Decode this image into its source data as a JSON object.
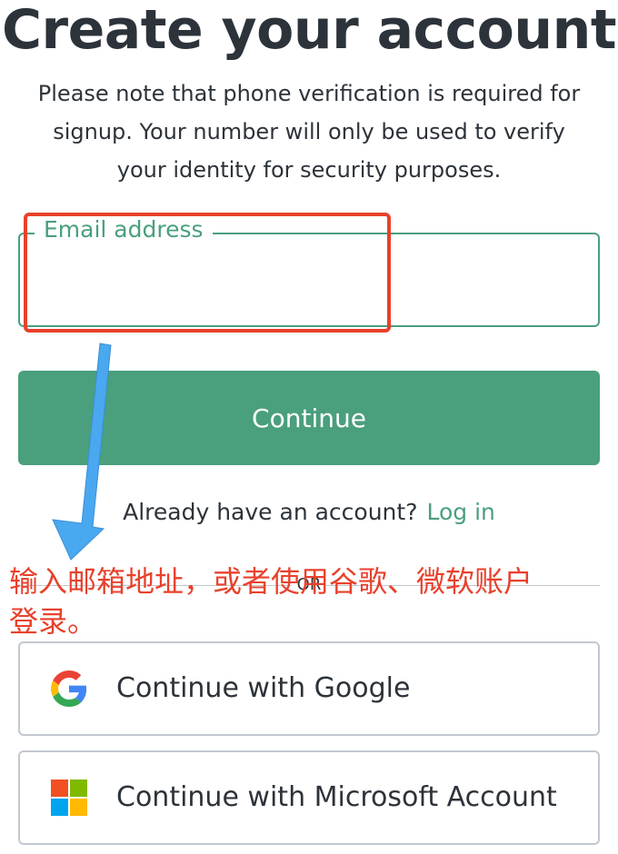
{
  "header": {
    "title": "Create your account",
    "note_line1": "Please note that phone verification is required for",
    "note_line2": "signup. Your number will only be used to verify",
    "note_line3": "your identity for security purposes."
  },
  "form": {
    "email_label": "Email address",
    "email_value": "",
    "continue_label": "Continue",
    "login_prompt": "Already have an account?",
    "login_link": "Log in",
    "or_label": "OR"
  },
  "social": {
    "google_label": "Continue with Google",
    "google_icon": "google-icon",
    "microsoft_label": "Continue with Microsoft Account",
    "microsoft_icon": "microsoft-icon"
  },
  "annotation": {
    "text": "输入邮箱地址，或者使用谷歌、微软账户登录。",
    "color": "#e8412c"
  },
  "colors": {
    "accent": "#4a9f7d",
    "text": "#2d333a",
    "border": "#c2c8d0",
    "annotation": "#e8412c"
  }
}
